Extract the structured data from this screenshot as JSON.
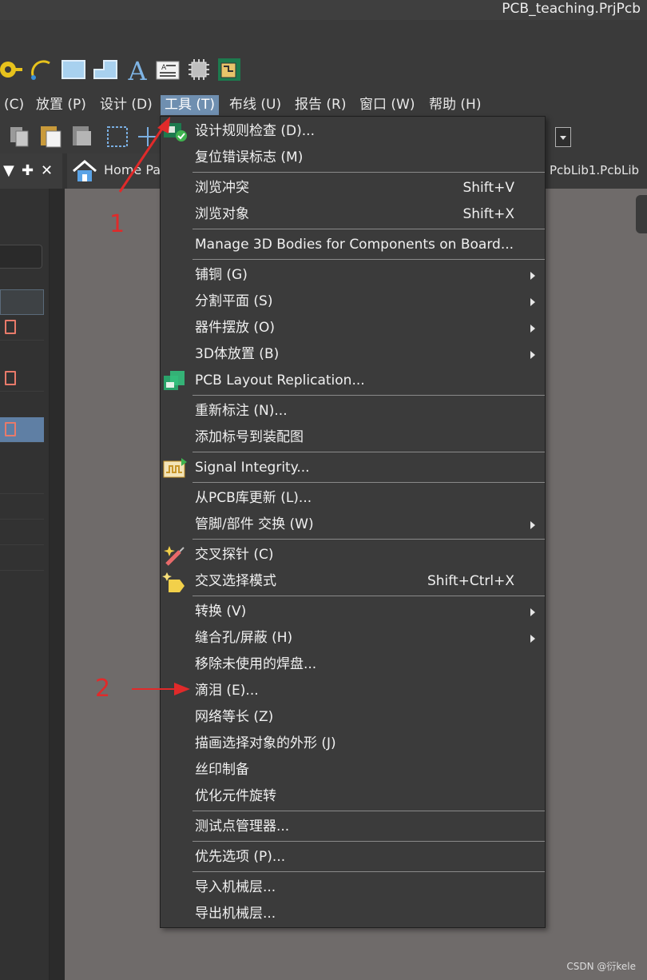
{
  "window": {
    "title": "PCB_teaching.PrjPcb"
  },
  "menubar": {
    "items": [
      {
        "label": "(C)"
      },
      {
        "label": "放置 (P)"
      },
      {
        "label": "设计 (D)"
      },
      {
        "label": "工具 (T)"
      },
      {
        "label": "布线 (U)"
      },
      {
        "label": "报告 (R)"
      },
      {
        "label": "窗口 (W)"
      },
      {
        "label": "帮助 (H)"
      }
    ],
    "active": "工具 (T)"
  },
  "tabs": {
    "home": "Home Pa",
    "right": "PcbLib1.PcbLib"
  },
  "dropdown_menu": {
    "items": [
      {
        "label": "设计规则检查 (D)...",
        "shortcut": "",
        "submenu": false,
        "icon": "drc-check-icon"
      },
      {
        "label": "复位错误标志 (M)",
        "shortcut": "",
        "submenu": false
      },
      {
        "label": "浏览冲突",
        "shortcut": "Shift+V",
        "submenu": false
      },
      {
        "label": "浏览对象",
        "shortcut": "Shift+X",
        "submenu": false
      },
      {
        "label": "Manage 3D Bodies for Components on Board...",
        "shortcut": "",
        "submenu": false
      },
      {
        "label": "铺铜 (G)",
        "shortcut": "",
        "submenu": true
      },
      {
        "label": "分割平面 (S)",
        "shortcut": "",
        "submenu": true
      },
      {
        "label": "器件摆放 (O)",
        "shortcut": "",
        "submenu": true
      },
      {
        "label": "3D体放置 (B)",
        "shortcut": "",
        "submenu": true
      },
      {
        "label": "PCB Layout Replication...",
        "shortcut": "",
        "submenu": false,
        "icon": "layout-replication-icon"
      },
      {
        "label": "重新标注 (N)...",
        "shortcut": "",
        "submenu": false
      },
      {
        "label": "添加标号到装配图",
        "shortcut": "",
        "submenu": false
      },
      {
        "label": "Signal Integrity...",
        "shortcut": "",
        "submenu": false,
        "icon": "signal-integrity-icon"
      },
      {
        "label": "从PCB库更新 (L)...",
        "shortcut": "",
        "submenu": false
      },
      {
        "label": "管脚/部件 交换 (W)",
        "shortcut": "",
        "submenu": true
      },
      {
        "label": "交叉探针 (C)",
        "shortcut": "",
        "submenu": false,
        "icon": "cross-probe-icon"
      },
      {
        "label": "交叉选择模式",
        "shortcut": "Shift+Ctrl+X",
        "submenu": false,
        "icon": "cross-select-icon"
      },
      {
        "label": "转换 (V)",
        "shortcut": "",
        "submenu": true
      },
      {
        "label": "缝合孔/屏蔽 (H)",
        "shortcut": "",
        "submenu": true
      },
      {
        "label": "移除未使用的焊盘...",
        "shortcut": "",
        "submenu": false
      },
      {
        "label": "滴泪 (E)...",
        "shortcut": "",
        "submenu": false
      },
      {
        "label": "网络等长 (Z)",
        "shortcut": "",
        "submenu": false
      },
      {
        "label": "描画选择对象的外形 (J)",
        "shortcut": "",
        "submenu": false
      },
      {
        "label": "丝印制备",
        "shortcut": "",
        "submenu": false
      },
      {
        "label": "优化元件旋转",
        "shortcut": "",
        "submenu": false
      },
      {
        "label": "测试点管理器...",
        "shortcut": "",
        "submenu": false
      },
      {
        "label": "优先选项 (P)...",
        "shortcut": "",
        "submenu": false
      },
      {
        "label": "导入机械层...",
        "shortcut": "",
        "submenu": false
      },
      {
        "label": "导出机械层...",
        "shortcut": "",
        "submenu": false
      }
    ]
  },
  "annotations": {
    "step1": "1",
    "step2": "2"
  },
  "watermark": "CSDN @衍kele",
  "colors": {
    "accent": "#6f8fb0",
    "annotation": "#e02a2a",
    "menu_bg": "#3b3b3b"
  }
}
